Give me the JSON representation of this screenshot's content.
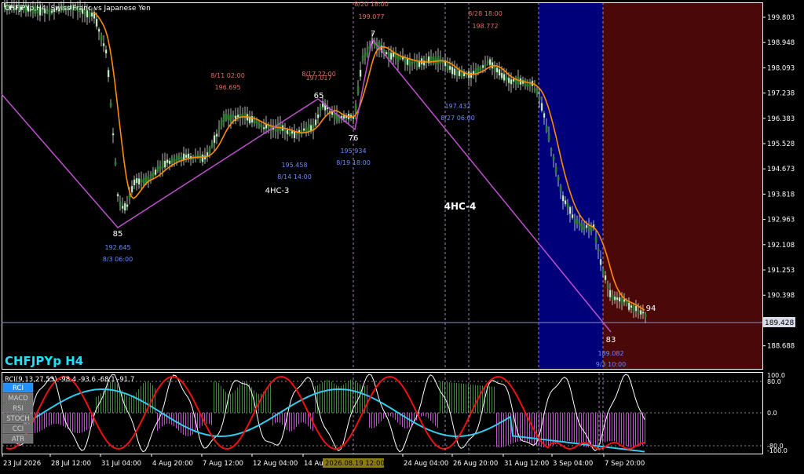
{
  "header": {
    "symbol_caption": "CHFJPYp,H4: Swiss Franc vs Japanese Yen",
    "chart_label": "CHFJPYp H4",
    "current_price": "189.428"
  },
  "colors": {
    "background": "#000000",
    "candle": "#2e7d32",
    "ma": "#ff8c00",
    "zigzag": "#c050d0",
    "zone_blue": "#00007a",
    "zone_red": "#4a0808",
    "annotation_red": "#e07060",
    "annotation_blue": "#6a8cff",
    "rci_white": "#ffffff",
    "rci_red": "#ee1111",
    "rci_cyan": "#33ccee",
    "hist_pos": "#3a8a3a",
    "hist_neg": "#c050d0",
    "accent_button": "#1e90ff"
  },
  "price_axis": {
    "ticks": [
      "199.803",
      "198.948",
      "198.093",
      "197.238",
      "196.383",
      "195.528",
      "194.673",
      "193.818",
      "192.963",
      "192.108",
      "191.253",
      "190.398",
      "189.543",
      "188.688"
    ]
  },
  "time_axis": {
    "ticks": [
      "23 Jul 2026",
      "28 Jul 12:00",
      "31 Jul 04:00",
      "4 Aug 20:00",
      "7 Aug 12:00",
      "12 Aug 04:00",
      "14 Au",
      "24 Aug 04:00",
      "26 Aug 20:00",
      "31 Aug 12:00",
      "3 Sep 04:00",
      "7 Sep 20:00"
    ],
    "cursor_time": "2026.08.19 12:00"
  },
  "swing_points": [
    {
      "label": "85",
      "price": "192.645",
      "time": "8/3 06:00",
      "color": "blue"
    },
    {
      "label": "65",
      "price": "197.017",
      "time": "8/17 22:00",
      "color": "red"
    },
    {
      "label": "76",
      "price": "195.934",
      "time": "8/19 18:00",
      "color": "blue"
    },
    {
      "label": "7",
      "price": "199.077",
      "time": "8/20 18:00",
      "color": "red"
    },
    {
      "label": "83",
      "price": "189.082",
      "time": "9/3 10:00",
      "color": "blue"
    },
    {
      "label": "94",
      "price": "",
      "time": "",
      "color": "white"
    }
  ],
  "other_annotations": [
    {
      "price": "196.695",
      "time": "8/11 02:00",
      "color": "red"
    },
    {
      "price": "195.458",
      "time": "8/14 14:00",
      "color": "blue"
    },
    {
      "price": "197.432",
      "time": "8/27 06:00",
      "color": "blue"
    },
    {
      "price": "198.772",
      "time": "8/28 18:00",
      "color": "red"
    }
  ],
  "wave_labels": [
    "4HC-3",
    "4HC-4"
  ],
  "indicator": {
    "caption": "RCI(9,13,27,53) -98.4 -93.6 -68.1 -91.7",
    "levels": [
      "100.0",
      "80.0",
      "0.0",
      "-80.0",
      "-100.0"
    ],
    "buttons": [
      {
        "label": "RCI",
        "active": true
      },
      {
        "label": "MACD",
        "active": false
      },
      {
        "label": "RSI",
        "active": false
      },
      {
        "label": "STOCH",
        "active": false
      },
      {
        "label": "CCI",
        "active": false
      },
      {
        "label": "ATR",
        "active": false
      }
    ]
  }
}
